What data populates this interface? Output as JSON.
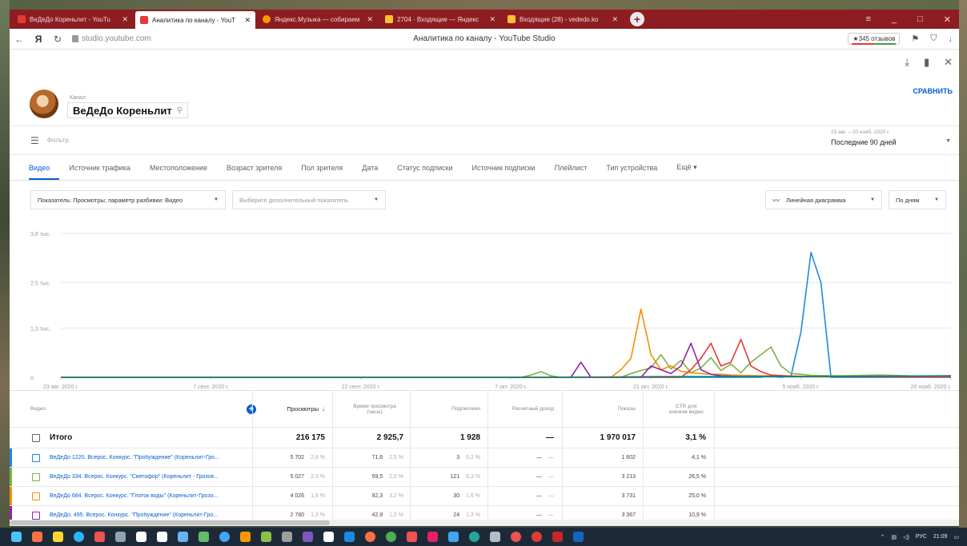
{
  "browser": {
    "tabs": [
      {
        "label": "ВеДеДо Кореньлит - YouTu",
        "active": false,
        "color": "#e53935"
      },
      {
        "label": "Аналитика по каналу - YouT",
        "active": true,
        "color": "#e53935"
      },
      {
        "label": "Яндекс.Музыка — собираем",
        "active": false,
        "color": "#ff9800"
      },
      {
        "label": "2704 · Входящие — Яндекс",
        "active": false,
        "color": "#fbc02d"
      },
      {
        "label": "Входящие (28) - vededo.ko",
        "active": false,
        "color": "#fbc02d"
      }
    ],
    "window_controls": [
      "≡",
      "_",
      "□",
      "✕"
    ],
    "url": "studio.youtube.com",
    "page_title": "Аналитика по каналу - YouTube Studio",
    "reviews": "★345 отзывов"
  },
  "channel": {
    "label": "Канал",
    "name": "ВеДеДо Кореньлит",
    "compare": "СРАВНИТЬ"
  },
  "filter": {
    "placeholder": "Фильтр",
    "date_small": "23 авг. – 20 нояб. 2020 г.",
    "date_big": "Последние 90 дней"
  },
  "tabs": [
    "Видео",
    "Источник трафика",
    "Местоположение",
    "Возраст зрителя",
    "Пол зрителя",
    "Дата",
    "Статус подписки",
    "Источник подписки",
    "Плейлист",
    "Тип устройства",
    "Ещё ▾"
  ],
  "controls": {
    "metric": "Показатель: Просмотры; параметр разбивки: Видео",
    "secondary": "Выберите дополнительный показатель",
    "chart_type": "Линейная диаграмма",
    "period": "По дням"
  },
  "chart_data": {
    "type": "line",
    "y_ticks": [
      "3,8 тыс.",
      "2,5 тыс.",
      "1,3 тыс.",
      "0"
    ],
    "y_tick_values": [
      3800,
      2500,
      1300,
      0
    ],
    "ylim": [
      0,
      3800
    ],
    "x_ticks": [
      "23 авг. 2020 г.",
      "7 сент. 2020 г.",
      "22 сент. 2020 г.",
      "7 окт. 2020 г.",
      "21 окт. 2020 г.",
      "5 нояб. 2020 г.",
      "20 нояб. 2020 г."
    ],
    "x_tick_days": [
      0,
      15,
      30,
      45,
      59,
      74,
      89
    ],
    "xlim": [
      0,
      89
    ],
    "grid": true,
    "series": [
      {
        "color": "#1e88e5",
        "points": [
          [
            0,
            0
          ],
          [
            70,
            0
          ],
          [
            70.5,
            40
          ],
          [
            71,
            30
          ],
          [
            72,
            0
          ],
          [
            73,
            30
          ],
          [
            74,
            1200
          ],
          [
            75,
            3300
          ],
          [
            76,
            2500
          ],
          [
            77,
            0
          ],
          [
            89,
            0
          ]
        ]
      },
      {
        "color": "#7cb342",
        "points": [
          [
            0,
            0
          ],
          [
            46,
            0
          ],
          [
            47,
            60
          ],
          [
            48,
            150
          ],
          [
            49,
            40
          ],
          [
            50,
            0
          ],
          [
            56,
            0
          ],
          [
            57,
            100
          ],
          [
            58,
            180
          ],
          [
            59,
            250
          ],
          [
            60,
            600
          ],
          [
            61,
            220
          ],
          [
            62,
            450
          ],
          [
            63,
            120
          ],
          [
            64,
            250
          ],
          [
            65,
            520
          ],
          [
            66,
            180
          ],
          [
            67,
            350
          ],
          [
            68,
            120
          ],
          [
            69,
            400
          ],
          [
            70,
            600
          ],
          [
            71,
            800
          ],
          [
            72,
            300
          ],
          [
            73,
            100
          ],
          [
            74,
            80
          ],
          [
            75,
            50
          ],
          [
            78,
            40
          ],
          [
            82,
            60
          ],
          [
            86,
            30
          ],
          [
            89,
            40
          ]
        ]
      },
      {
        "color": "#fb8c00",
        "points": [
          [
            0,
            0
          ],
          [
            55,
            0
          ],
          [
            56,
            200
          ],
          [
            57,
            500
          ],
          [
            58,
            1800
          ],
          [
            59,
            600
          ],
          [
            60,
            200
          ],
          [
            61,
            300
          ],
          [
            62,
            160
          ],
          [
            63,
            120
          ],
          [
            64,
            100
          ],
          [
            65,
            80
          ],
          [
            66,
            80
          ],
          [
            67,
            60
          ],
          [
            70,
            40
          ],
          [
            74,
            30
          ],
          [
            89,
            20
          ]
        ]
      },
      {
        "color": "#8e24aa",
        "points": [
          [
            0,
            0
          ],
          [
            51,
            0
          ],
          [
            52,
            400
          ],
          [
            53,
            0
          ],
          [
            58,
            0
          ],
          [
            59,
            300
          ],
          [
            60,
            200
          ],
          [
            61,
            100
          ],
          [
            62,
            300
          ],
          [
            63,
            900
          ],
          [
            64,
            200
          ],
          [
            65,
            80
          ],
          [
            66,
            40
          ],
          [
            68,
            20
          ],
          [
            89,
            10
          ]
        ]
      },
      {
        "color": "#e53935",
        "points": [
          [
            0,
            0
          ],
          [
            62,
            0
          ],
          [
            63,
            200
          ],
          [
            64,
            500
          ],
          [
            65,
            900
          ],
          [
            66,
            300
          ],
          [
            67,
            400
          ],
          [
            68,
            1000
          ],
          [
            69,
            300
          ],
          [
            70,
            150
          ],
          [
            71,
            60
          ],
          [
            74,
            20
          ],
          [
            89,
            10
          ]
        ]
      },
      {
        "color": "#00897b",
        "points": [
          [
            0,
            0
          ],
          [
            45,
            0
          ],
          [
            55,
            10
          ],
          [
            60,
            20
          ],
          [
            75,
            20
          ],
          [
            89,
            40
          ]
        ]
      }
    ]
  },
  "table": {
    "headers": {
      "video": "Видео",
      "views": "Просмотры",
      "watch_time": "Время просмотра (часы)",
      "subscribers": "Подписчики",
      "revenue": "Расчетный доход",
      "impressions": "Показы",
      "ctr": "CTR для значков видео"
    },
    "total": {
      "label": "Итого",
      "views": "216 175",
      "watch_time": "2 925,7",
      "subscribers": "1 928",
      "revenue": "—",
      "impressions": "1 970 017",
      "ctr": "3,1 %"
    },
    "rows": [
      {
        "color": "#1e88e5",
        "title": "ВеДеДо 1220. Всерос. Конкурс. \"Пробуждение\" (Кореньлит-Гро...",
        "views": "5 702",
        "views_pct": "2,6 %",
        "watch": "71,6",
        "watch_pct": "2,5 %",
        "subs": "3",
        "subs_pct": "0,2 %",
        "revenue": "—",
        "revenue2": "—",
        "impressions": "1 602",
        "ctr": "4,1 %"
      },
      {
        "color": "#7cb342",
        "title": "ВеДеДо 334. Всерос. Конкурс. \"Светофор\" (Кореньлит - Грозов...",
        "views": "5 027",
        "views_pct": "2,3 %",
        "watch": "59,5",
        "watch_pct": "2,0 %",
        "subs": "121",
        "subs_pct": "6,3 %",
        "revenue": "—",
        "revenue2": "—",
        "impressions": "3 213",
        "ctr": "26,5 %"
      },
      {
        "color": "#fb8c00",
        "title": "ВеДеДо 684. Всерос. Конкурс. \"Глоток воды\" (Кореньлит-Грозо...",
        "views": "4 026",
        "views_pct": "1,9 %",
        "watch": "92,3",
        "watch_pct": "3,2 %",
        "subs": "30",
        "subs_pct": "1,6 %",
        "revenue": "—",
        "revenue2": "—",
        "impressions": "3 731",
        "ctr": "25,0 %"
      },
      {
        "color": "#8e24aa",
        "title": "ВеДеДо. 495. Всерос. Конкурс. \"Пробуждение\" (Кореньлит-Гро...",
        "views": "2 780",
        "views_pct": "1,3 %",
        "watch": "42,9",
        "watch_pct": "1,5 %",
        "subs": "24",
        "subs_pct": "1,3 %",
        "revenue": "—",
        "revenue2": "—",
        "impressions": "3 367",
        "ctr": "10,9 %"
      }
    ]
  },
  "taskbar": {
    "tray_lang": "РУС",
    "time": "21:09"
  }
}
